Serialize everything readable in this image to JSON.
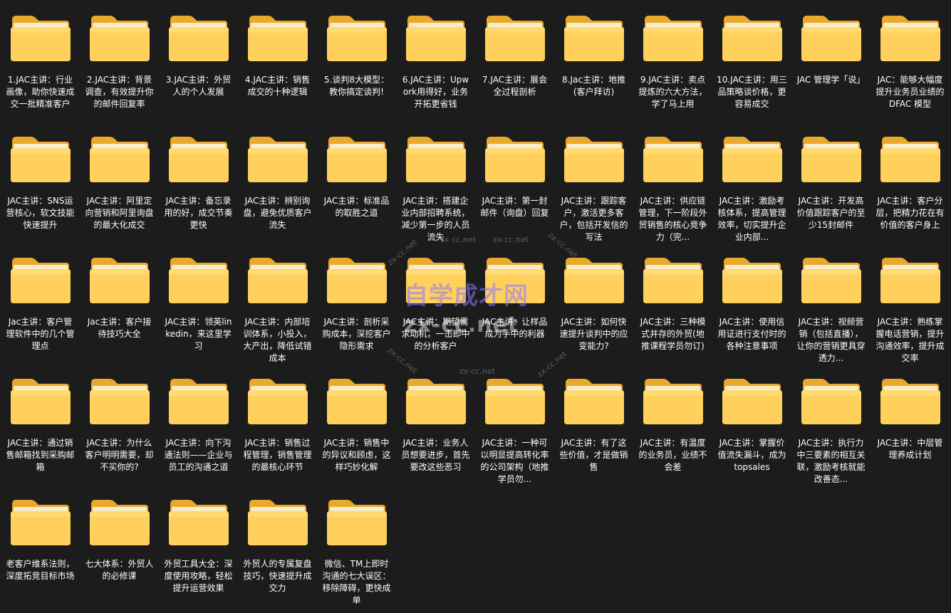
{
  "folders": [
    "1.JAC主讲：行业画像，助你快速成交一批精准客户",
    "2.JAC主讲：背景调查，有效提升你的邮件回复率",
    "3.JAC主讲：外贸人的个人发展",
    "4.JAC主讲：销售成交的十种逻辑",
    "5.谈判8大模型：教你搞定谈判!",
    "6.JAC主讲：Upwork用得好，业务开拓更省钱",
    "7.JAC主讲：展会全过程剖析",
    "8.Jac主讲：地推(客户拜访)",
    "9.JAC主讲：卖点提炼的六大方法，学了马上用",
    "10.JAC主讲：用三品策略谈价格，更容易成交",
    "JAC 管理学「说」",
    "JAC：能够大幅度提升业务员业绩的 DFAC 模型",
    "JAC主讲：SNS运营核心，软文技能快速提升",
    "JAC主讲：阿里定向营销和阿里询盘的最大化成交",
    "JAC主讲：备忘录用的好，成交节奏更快",
    "JAC主讲：辨别询盘，避免优质客户流失",
    "JAC主讲：标准品的取胜之道",
    "JAC主讲：搭建企业内部招聘系统，减少第一步的人员流失",
    "JAC主讲：第一封邮件（询盘）回复",
    "JAC主讲：跟踪客户，激活更多客户，包括开发信的写法",
    "JAC主讲：供应链管理，下一阶段外贸销售的核心竞争力（完...",
    "JAC主讲：激励考核体系，提高管理效率，切实提升企业内部...",
    "JAC主讲：开发高价值跟踪客户的至少15封邮件",
    "JAC主讲：客户分层，把精力花在有价值的客户身上",
    "Jac主讲：客户管理软件中的几个管理点",
    "Jac主讲：客户接待技巧大全",
    "JAC主讲：领英linkedin，来这里学习",
    "JAC主讲：内部培训体系，小投入，大产出，降低试错成本",
    "JAC主讲：剖析采购成本，深挖客户隐形需求",
    "JAC主讲：期望需求动机，一击即中的分析客户",
    "JAC主讲：让样品成为手中的利器",
    "JAC主讲：如何快速提升谈判中的应变能力?",
    "JAC主讲：三种模式并存的外贸(地推课程学员勿订)",
    "JAC主讲：使用信用证进行支付时的各种注意事项",
    "JAC主讲：视频营销（包括直播），让你的营销更具穿透力...",
    "JAC主讲：熟练掌握电话营销，提升沟通效率，提升成交率",
    "JAC主讲：通过销售邮箱找到采购邮箱",
    "JAC主讲：为什么客户明明需要，却不买你的?",
    "JAC主讲：向下沟通法则——企业与员工的沟通之道",
    "JAC主讲：销售过程管理，销售管理的最核心环节",
    "JAC主讲：销售中的异议和顾虑，这样巧妙化解",
    "JAC主讲：业务人员想要进步，首先要改这些恶习",
    "JAC主讲：一种可以明显提高转化率的公司架构（地推学员勿...",
    "JAC主讲：有了这些价值，才是做销售",
    "JAC主讲：有温度的业务员，业绩不会差",
    "JAC主讲：掌握价值流失漏斗，成为topsales",
    "JAC主讲：执行力中三要素的相互关联，激励考核就能改善态...",
    "JAC主讲：中层管理养成计划",
    "老客户维系法则，深度拓竞目标市场",
    "七大体系：外贸人的必修课",
    "外贸工具大全：深度使用攻略，轻松提升运营效果",
    "外贸人的专属复盘技巧，快速提升成交力",
    "微信、TM上即时沟通的七大误区：移除障碍，更快成单"
  ],
  "watermark": {
    "title": "自学成才网",
    "domain": "zx-cc.net",
    "small": "zx-cc.net"
  },
  "colors": {
    "background": "#1c1c1c",
    "folder_back": "#e9a92c",
    "folder_front": "#ffd15c",
    "folder_tab": "#f2b535",
    "label_text": "#ffffff"
  },
  "icons": {
    "folder": "folder-icon"
  }
}
